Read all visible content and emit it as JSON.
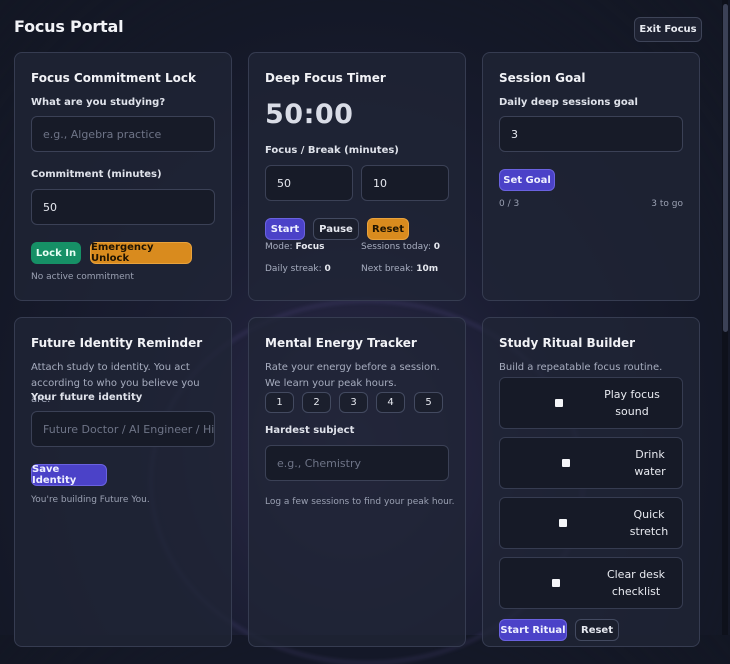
{
  "app": {
    "title": "Focus Portal",
    "exit_label": "Exit Focus"
  },
  "lock": {
    "title": "Focus Commitment Lock",
    "study_label": "What are you studying?",
    "study_placeholder": "e.g., Algebra practice",
    "minutes_label": "Commitment (minutes)",
    "minutes_value": "50",
    "lock_btn": "Lock In",
    "unlock_btn": "Emergency Unlock",
    "status": "No active commitment"
  },
  "timer": {
    "title": "Deep Focus Timer",
    "display": "50:00",
    "fb_label": "Focus / Break (minutes)",
    "focus_value": "50",
    "break_value": "10",
    "start_btn": "Start",
    "pause_btn": "Pause",
    "reset_btn": "Reset",
    "mode_label": "Mode:",
    "mode_value": "Focus",
    "sessions_label": "Sessions today:",
    "sessions_value": "0",
    "streak_label": "Daily streak:",
    "streak_value": "0",
    "next_label": "Next break:",
    "next_value": "10m"
  },
  "goal": {
    "title": "Session Goal",
    "label": "Daily deep sessions goal",
    "value": "3",
    "btn": "Set Goal",
    "progress": "0 / 3",
    "remaining": "3 to go"
  },
  "identity": {
    "title": "Future Identity Reminder",
    "desc": "Attach study to identity. You act according to who you believe you are.",
    "field_label": "Your future identity",
    "placeholder": "Future Doctor / AI Engineer / Hist",
    "btn": "Save Identity",
    "status": "You're building Future You."
  },
  "energy": {
    "title": "Mental Energy Tracker",
    "desc": "Rate your energy before a session. We learn your peak hours.",
    "levels": [
      "1",
      "2",
      "3",
      "4",
      "5"
    ],
    "subject_label": "Hardest subject",
    "subject_placeholder": "e.g., Chemistry",
    "hint": "Log a few sessions to find your peak hour."
  },
  "ritual": {
    "title": "Study Ritual Builder",
    "desc": "Build a repeatable focus routine.",
    "items": [
      "Play focus sound",
      "Drink water",
      "Quick stretch",
      "Clear desk checklist"
    ],
    "start_btn": "Start Ritual",
    "reset_btn": "Reset"
  }
}
